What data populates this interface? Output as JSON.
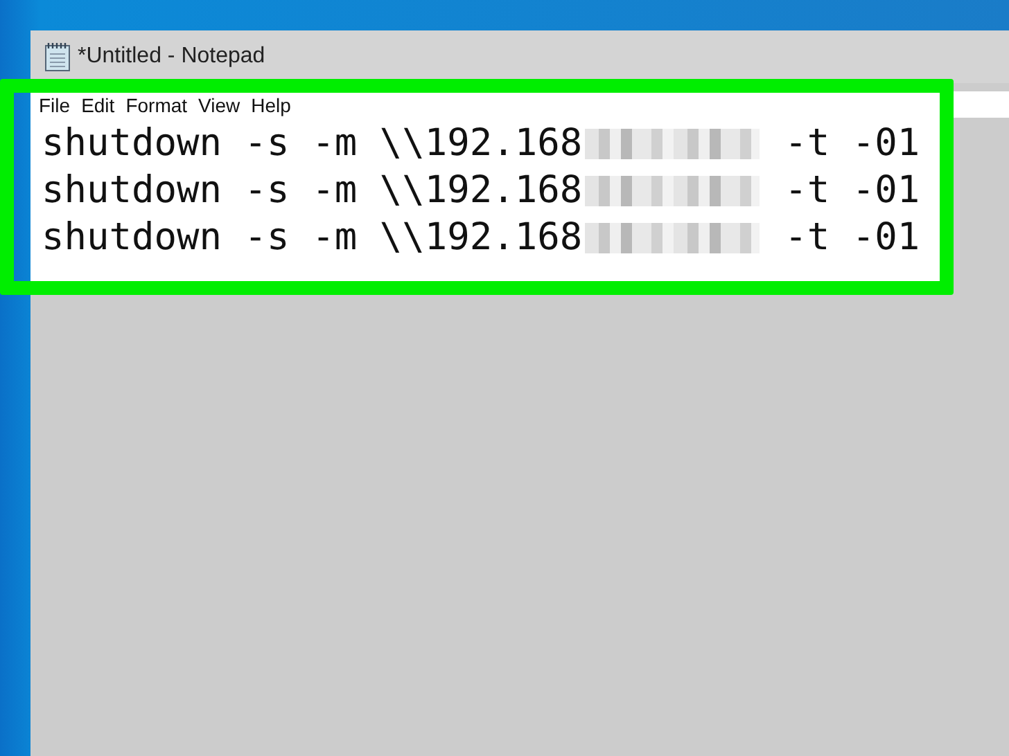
{
  "window": {
    "title": "*Untitled - Notepad"
  },
  "menu": [
    "File",
    "Edit",
    "Format",
    "View",
    "Help"
  ],
  "lines": [
    {
      "before": "shutdown -s -m \\\\192.168",
      "after": "-t -01",
      "redacted": true
    },
    {
      "before": "shutdown -s -m \\\\192.168",
      "after": "-t -01",
      "redacted": true
    },
    {
      "before": "shutdown -s -m \\\\192.168",
      "after": "-t -01",
      "redacted": true
    }
  ],
  "highlight": {
    "on": true
  }
}
